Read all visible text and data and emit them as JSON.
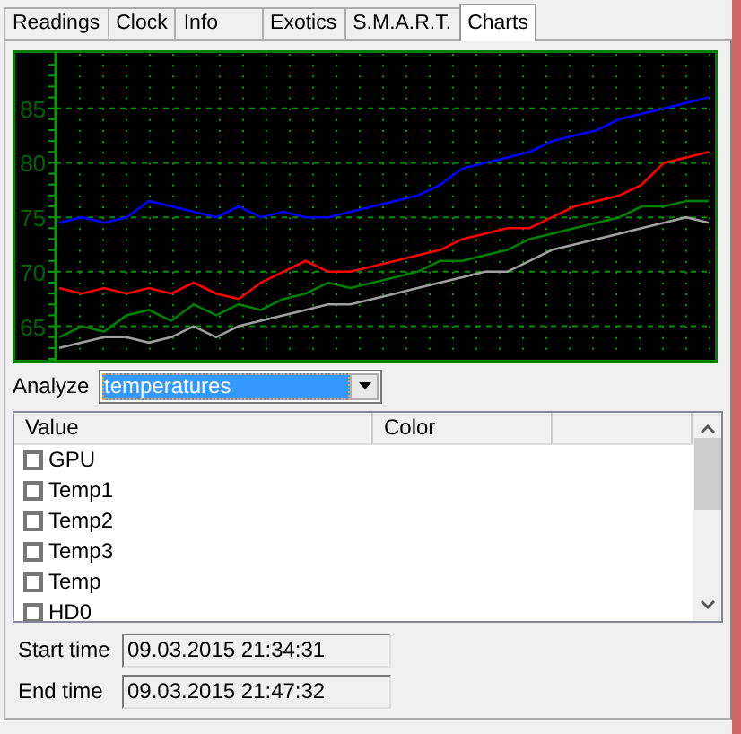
{
  "tabs": [
    {
      "label": "Readings",
      "selected": false
    },
    {
      "label": "Clock",
      "selected": false
    },
    {
      "label": "Info",
      "selected": false
    },
    {
      "label": "Exotics",
      "selected": false
    },
    {
      "label": "S.M.A.R.T.",
      "selected": false
    },
    {
      "label": "Charts",
      "selected": true
    }
  ],
  "chart": {
    "chart_data": {
      "type": "line",
      "grid": true,
      "ylim": [
        62,
        90
      ],
      "yticks": [
        65,
        70,
        75,
        80,
        85
      ],
      "series": [
        {
          "color": "#0000ff",
          "values": [
            74.5,
            75,
            74.5,
            75,
            76.5,
            76,
            75.5,
            75,
            76,
            75,
            75.5,
            75,
            75,
            75.5,
            76,
            76.5,
            77,
            78,
            79.5,
            80,
            80.5,
            81,
            82,
            82.5,
            83,
            84,
            84.5,
            85,
            85.5,
            86
          ]
        },
        {
          "color": "#ff0000",
          "values": [
            68.5,
            68,
            68.5,
            68,
            68.5,
            68,
            69,
            68,
            67.5,
            69,
            70,
            71,
            70,
            70,
            70.5,
            71,
            71.5,
            72,
            73,
            73.5,
            74,
            74,
            75,
            76,
            76.5,
            77,
            78,
            80,
            80.5,
            81
          ]
        },
        {
          "color": "#008000",
          "values": [
            64,
            65,
            64.5,
            66,
            66.5,
            65.5,
            67,
            66,
            67,
            66.5,
            67.5,
            68,
            69,
            68.5,
            69,
            69.5,
            70,
            71,
            71,
            71.5,
            72,
            73,
            73.5,
            74,
            74.5,
            75,
            76,
            76,
            76.5,
            76.5
          ]
        },
        {
          "color": "#a0a0a0",
          "values": [
            63,
            63.5,
            64,
            64,
            63.5,
            64,
            65,
            64,
            65,
            65.5,
            66,
            66.5,
            67,
            67,
            67.5,
            68,
            68.5,
            69,
            69.5,
            70,
            70,
            71,
            72,
            72.5,
            73,
            73.5,
            74,
            74.5,
            75,
            74.5
          ]
        }
      ]
    }
  },
  "analyze": {
    "label": "Analyze",
    "value": "temperatures"
  },
  "list": {
    "columns": [
      "Value",
      "Color"
    ],
    "rows": [
      {
        "label": "GPU",
        "checked": false
      },
      {
        "label": "Temp1",
        "checked": false
      },
      {
        "label": "Temp2",
        "checked": false
      },
      {
        "label": "Temp3",
        "checked": false
      },
      {
        "label": "Temp",
        "checked": false
      },
      {
        "label": "HD0",
        "checked": false
      }
    ]
  },
  "times": [
    {
      "label": "Start time",
      "value": "09.03.2015 21:34:31"
    },
    {
      "label": "End time",
      "value": "09.03.2015 21:47:32"
    }
  ]
}
